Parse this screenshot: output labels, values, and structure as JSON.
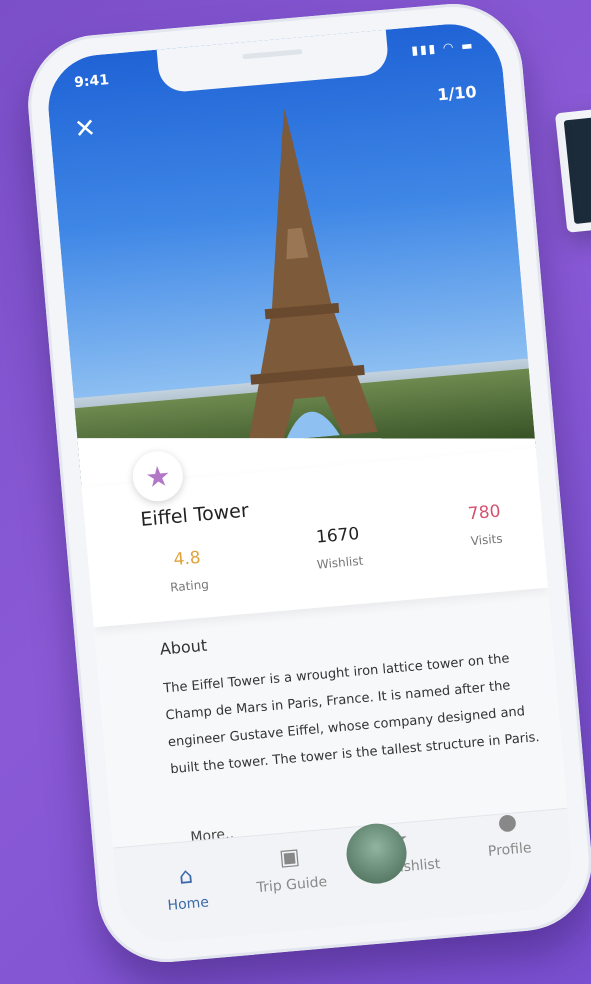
{
  "status": {
    "time": "9:41"
  },
  "header": {
    "counter": "1/10"
  },
  "place": {
    "name": "Eiffel Tower",
    "stats": [
      {
        "value": "4.8",
        "label": "Rating",
        "color": "#e0a33a"
      },
      {
        "value": "1670",
        "label": "Wishlist",
        "color": "#222222"
      },
      {
        "value": "780",
        "label": "Visits",
        "color": "#d6506e"
      }
    ]
  },
  "about": {
    "heading": "About",
    "text": "The Eiffel Tower is a wrought iron lattice tower on the Champ de Mars in Paris, France. It is named after the engineer Gustave Eiffel, whose company designed and built the tower. The tower is the tallest structure in Paris.",
    "more": "More.."
  },
  "tabs": [
    {
      "label": "Home",
      "icon": "home-icon",
      "active": true
    },
    {
      "label": "Trip Guide",
      "icon": "map-icon",
      "active": false
    },
    {
      "label": "My Wishlist",
      "icon": "star-icon",
      "active": false
    },
    {
      "label": "Profile",
      "icon": "user-icon",
      "active": false
    }
  ],
  "colors": {
    "accent": "#3a6aa8",
    "favorite": "#b377c7"
  }
}
